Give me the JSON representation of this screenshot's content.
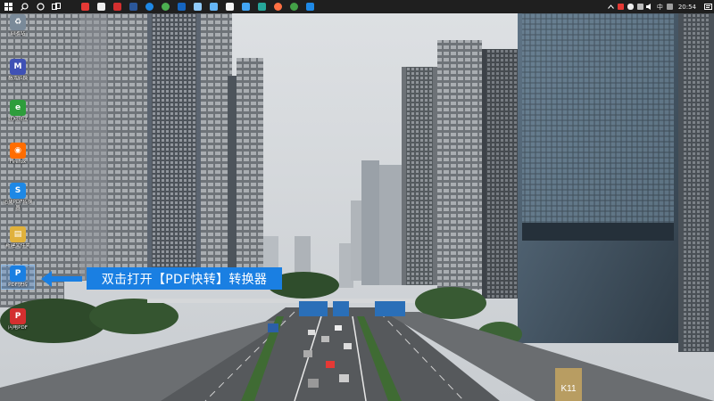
{
  "taskbar": {
    "clock": "20:54",
    "ime": "中",
    "apps": [
      {
        "name": "pdf-app",
        "color": "#e53935",
        "shape": "sq"
      },
      {
        "name": "camera-app",
        "color": "#eeeeee",
        "shape": "sq"
      },
      {
        "name": "red-app",
        "color": "#d32f2f",
        "shape": "sq"
      },
      {
        "name": "word-app",
        "color": "#2b579a",
        "shape": "sq"
      },
      {
        "name": "edge-app",
        "color": "#1e88e5",
        "shape": "dot"
      },
      {
        "name": "chrome-app",
        "color": "#4caf50",
        "shape": "dot"
      },
      {
        "name": "notes-app",
        "color": "#1565c0",
        "shape": "sq"
      },
      {
        "name": "photo-app",
        "color": "#90caf9",
        "shape": "sq"
      },
      {
        "name": "monitor-app",
        "color": "#64b5f6",
        "shape": "sq"
      },
      {
        "name": "doc-app",
        "color": "#f5f5f5",
        "shape": "sq"
      },
      {
        "name": "screen-app",
        "color": "#42a5f5",
        "shape": "sq"
      },
      {
        "name": "settings-app",
        "color": "#26a69a",
        "shape": "sq"
      },
      {
        "name": "firefox-app",
        "color": "#ff7043",
        "shape": "dot"
      },
      {
        "name": "wechat-app",
        "color": "#43a047",
        "shape": "dot"
      },
      {
        "name": "blue-app",
        "color": "#1e88e5",
        "shape": "sq"
      }
    ]
  },
  "desktop": {
    "icons": [
      {
        "label": "回收站",
        "glyph": "♻",
        "color": "#7a8a99"
      },
      {
        "label": "格式转换",
        "glyph": "M",
        "color": "#3f51b5"
      },
      {
        "label": "联网测试",
        "glyph": "e",
        "color": "#2e9d3b"
      },
      {
        "label": "Firefox",
        "glyph": "◉",
        "color": "#ff6d00"
      },
      {
        "label": "迅捷PDF转换器",
        "glyph": "S",
        "color": "#1e88e5"
      },
      {
        "label": "新建文件夹",
        "glyph": "▤",
        "color": "#e0b13c"
      },
      {
        "label": "PDF快转",
        "glyph": "P",
        "color": "#1a7fe2"
      },
      {
        "label": "闪电PDF",
        "glyph": "P",
        "color": "#d32f2f"
      }
    ]
  },
  "callout": {
    "text": "双击打开【PDF快转】转换器"
  },
  "wallpaper": {
    "sign_text": "K11"
  }
}
